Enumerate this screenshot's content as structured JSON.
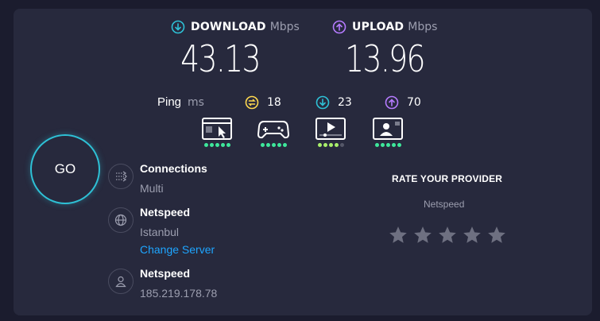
{
  "download": {
    "label": "DOWNLOAD",
    "unit": "Mbps",
    "value": "43.13",
    "color": "#2ec1d6"
  },
  "upload": {
    "label": "UPLOAD",
    "unit": "Mbps",
    "value": "13.96",
    "color": "#b57bff"
  },
  "ping": {
    "label": "Ping",
    "unit": "ms",
    "idle": "18",
    "download": "23",
    "upload": "70",
    "idle_color": "#ffd84f"
  },
  "capabilities": [
    {
      "icon": "web-browsing-icon",
      "rating": 5
    },
    {
      "icon": "gaming-icon",
      "rating": 5
    },
    {
      "icon": "video-streaming-icon",
      "rating": 4
    },
    {
      "icon": "video-chat-icon",
      "rating": 5
    }
  ],
  "go_button": {
    "label": "GO",
    "color": "#2ec1d6"
  },
  "connections": {
    "title": "Connections",
    "value": "Multi",
    "icon": "connections-icon"
  },
  "server": {
    "title": "Netspeed",
    "location": "Istanbul",
    "change_label": "Change Server",
    "icon": "globe-icon"
  },
  "provider": {
    "title": "Netspeed",
    "ip": "185.219.178.78",
    "icon": "user-icon"
  },
  "rating": {
    "title": "RATE YOUR PROVIDER",
    "provider": "Netspeed",
    "stars": 5,
    "star_color": "#6e7081"
  },
  "colors": {
    "background": "#1b1c2e",
    "panel": "#27293d",
    "link": "#1ea5ff",
    "rating_green": "#3ee89b"
  }
}
